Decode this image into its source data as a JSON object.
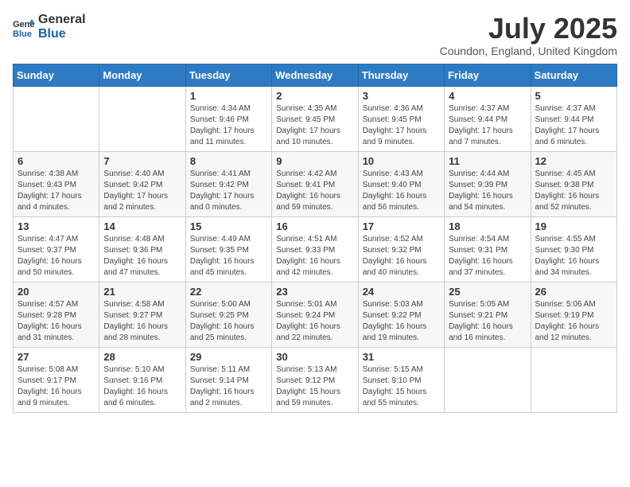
{
  "header": {
    "logo_general": "General",
    "logo_blue": "Blue",
    "month_year": "July 2025",
    "location": "Coundon, England, United Kingdom"
  },
  "days_of_week": [
    "Sunday",
    "Monday",
    "Tuesday",
    "Wednesday",
    "Thursday",
    "Friday",
    "Saturday"
  ],
  "weeks": [
    [
      {
        "day": "",
        "info": ""
      },
      {
        "day": "",
        "info": ""
      },
      {
        "day": "1",
        "info": "Sunrise: 4:34 AM\nSunset: 9:46 PM\nDaylight: 17 hours and 11 minutes."
      },
      {
        "day": "2",
        "info": "Sunrise: 4:35 AM\nSunset: 9:45 PM\nDaylight: 17 hours and 10 minutes."
      },
      {
        "day": "3",
        "info": "Sunrise: 4:36 AM\nSunset: 9:45 PM\nDaylight: 17 hours and 9 minutes."
      },
      {
        "day": "4",
        "info": "Sunrise: 4:37 AM\nSunset: 9:44 PM\nDaylight: 17 hours and 7 minutes."
      },
      {
        "day": "5",
        "info": "Sunrise: 4:37 AM\nSunset: 9:44 PM\nDaylight: 17 hours and 6 minutes."
      }
    ],
    [
      {
        "day": "6",
        "info": "Sunrise: 4:38 AM\nSunset: 9:43 PM\nDaylight: 17 hours and 4 minutes."
      },
      {
        "day": "7",
        "info": "Sunrise: 4:40 AM\nSunset: 9:42 PM\nDaylight: 17 hours and 2 minutes."
      },
      {
        "day": "8",
        "info": "Sunrise: 4:41 AM\nSunset: 9:42 PM\nDaylight: 17 hours and 0 minutes."
      },
      {
        "day": "9",
        "info": "Sunrise: 4:42 AM\nSunset: 9:41 PM\nDaylight: 16 hours and 59 minutes."
      },
      {
        "day": "10",
        "info": "Sunrise: 4:43 AM\nSunset: 9:40 PM\nDaylight: 16 hours and 56 minutes."
      },
      {
        "day": "11",
        "info": "Sunrise: 4:44 AM\nSunset: 9:39 PM\nDaylight: 16 hours and 54 minutes."
      },
      {
        "day": "12",
        "info": "Sunrise: 4:45 AM\nSunset: 9:38 PM\nDaylight: 16 hours and 52 minutes."
      }
    ],
    [
      {
        "day": "13",
        "info": "Sunrise: 4:47 AM\nSunset: 9:37 PM\nDaylight: 16 hours and 50 minutes."
      },
      {
        "day": "14",
        "info": "Sunrise: 4:48 AM\nSunset: 9:36 PM\nDaylight: 16 hours and 47 minutes."
      },
      {
        "day": "15",
        "info": "Sunrise: 4:49 AM\nSunset: 9:35 PM\nDaylight: 16 hours and 45 minutes."
      },
      {
        "day": "16",
        "info": "Sunrise: 4:51 AM\nSunset: 9:33 PM\nDaylight: 16 hours and 42 minutes."
      },
      {
        "day": "17",
        "info": "Sunrise: 4:52 AM\nSunset: 9:32 PM\nDaylight: 16 hours and 40 minutes."
      },
      {
        "day": "18",
        "info": "Sunrise: 4:54 AM\nSunset: 9:31 PM\nDaylight: 16 hours and 37 minutes."
      },
      {
        "day": "19",
        "info": "Sunrise: 4:55 AM\nSunset: 9:30 PM\nDaylight: 16 hours and 34 minutes."
      }
    ],
    [
      {
        "day": "20",
        "info": "Sunrise: 4:57 AM\nSunset: 9:28 PM\nDaylight: 16 hours and 31 minutes."
      },
      {
        "day": "21",
        "info": "Sunrise: 4:58 AM\nSunset: 9:27 PM\nDaylight: 16 hours and 28 minutes."
      },
      {
        "day": "22",
        "info": "Sunrise: 5:00 AM\nSunset: 9:25 PM\nDaylight: 16 hours and 25 minutes."
      },
      {
        "day": "23",
        "info": "Sunrise: 5:01 AM\nSunset: 9:24 PM\nDaylight: 16 hours and 22 minutes."
      },
      {
        "day": "24",
        "info": "Sunrise: 5:03 AM\nSunset: 9:22 PM\nDaylight: 16 hours and 19 minutes."
      },
      {
        "day": "25",
        "info": "Sunrise: 5:05 AM\nSunset: 9:21 PM\nDaylight: 16 hours and 16 minutes."
      },
      {
        "day": "26",
        "info": "Sunrise: 5:06 AM\nSunset: 9:19 PM\nDaylight: 16 hours and 12 minutes."
      }
    ],
    [
      {
        "day": "27",
        "info": "Sunrise: 5:08 AM\nSunset: 9:17 PM\nDaylight: 16 hours and 9 minutes."
      },
      {
        "day": "28",
        "info": "Sunrise: 5:10 AM\nSunset: 9:16 PM\nDaylight: 16 hours and 6 minutes."
      },
      {
        "day": "29",
        "info": "Sunrise: 5:11 AM\nSunset: 9:14 PM\nDaylight: 16 hours and 2 minutes."
      },
      {
        "day": "30",
        "info": "Sunrise: 5:13 AM\nSunset: 9:12 PM\nDaylight: 15 hours and 59 minutes."
      },
      {
        "day": "31",
        "info": "Sunrise: 5:15 AM\nSunset: 9:10 PM\nDaylight: 15 hours and 55 minutes."
      },
      {
        "day": "",
        "info": ""
      },
      {
        "day": "",
        "info": ""
      }
    ]
  ]
}
